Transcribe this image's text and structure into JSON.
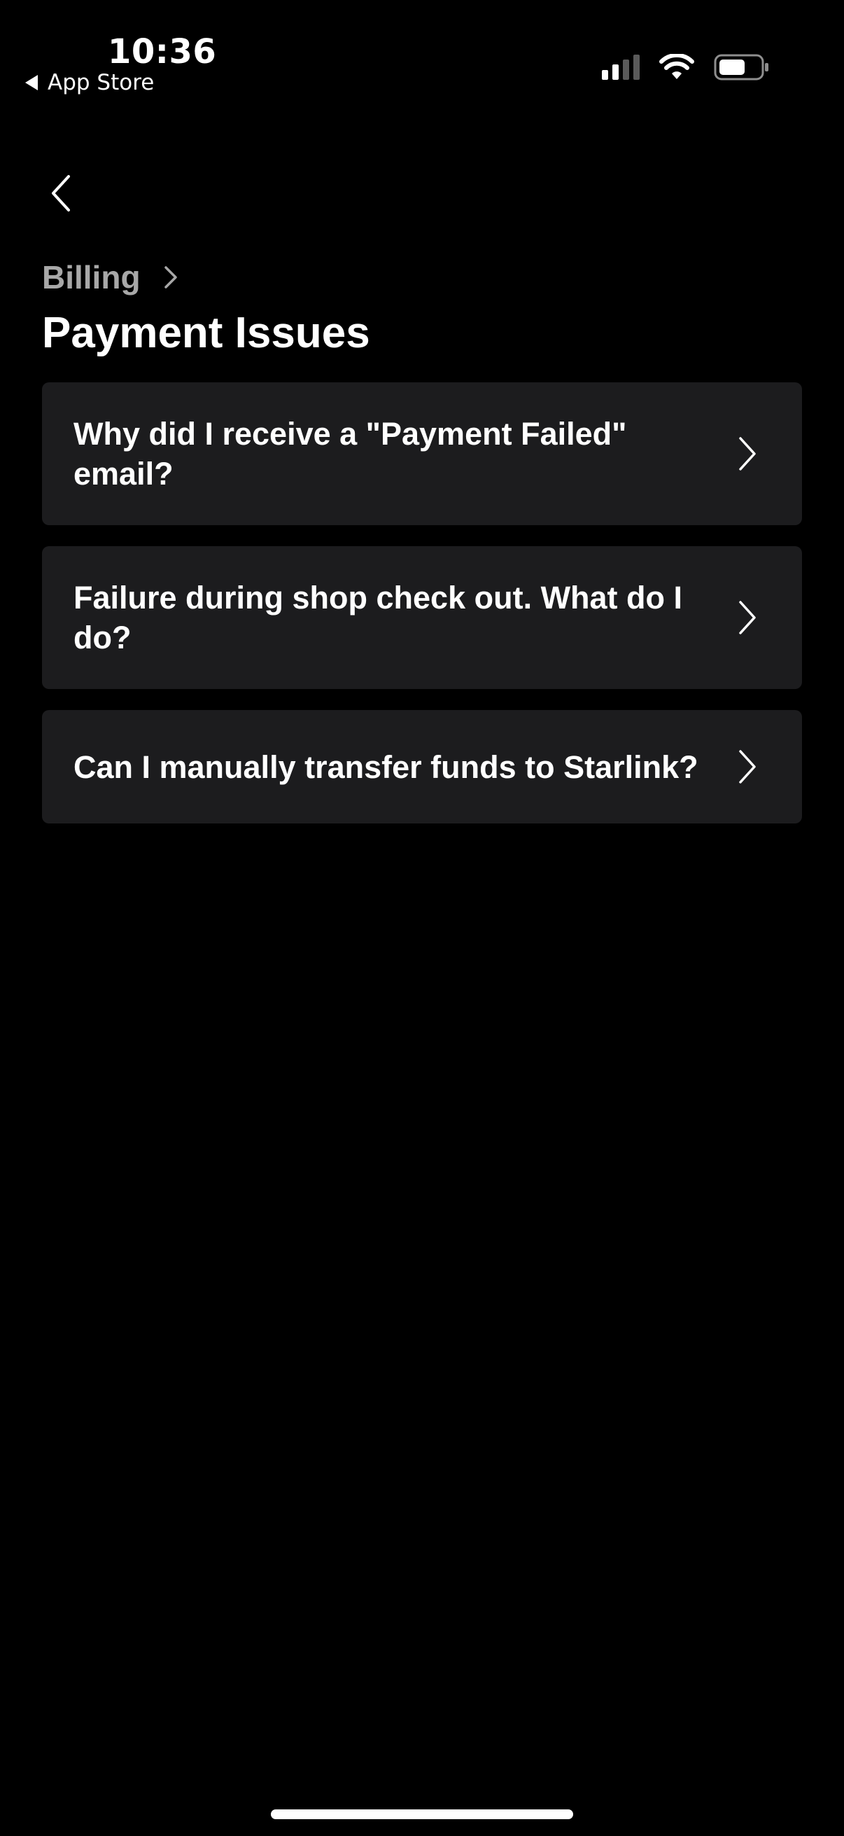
{
  "status_bar": {
    "time": "10:36",
    "back_app": "App Store",
    "icons": [
      "cellular-signal-icon",
      "wifi-icon",
      "battery-icon"
    ]
  },
  "nav": {
    "back_icon": "chevron-left-icon"
  },
  "breadcrumb": {
    "parent": "Billing",
    "separator_icon": "chevron-right-icon"
  },
  "page": {
    "title": "Payment Issues"
  },
  "articles": [
    {
      "label": "Why did I receive a \"Payment Failed\" email?",
      "icon": "chevron-right-icon"
    },
    {
      "label": "Failure during shop check out. What do I do?",
      "icon": "chevron-right-icon"
    },
    {
      "label": "Can I manually transfer funds to Starlink?",
      "icon": "chevron-right-icon"
    }
  ],
  "colors": {
    "background": "#000000",
    "card": "#1c1c1e",
    "text_primary": "#ffffff",
    "text_secondary": "#a8a8a8"
  }
}
